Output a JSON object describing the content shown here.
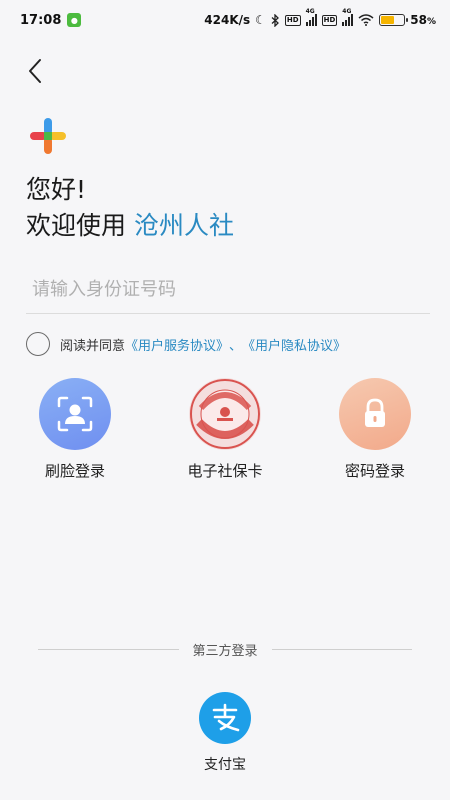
{
  "status_bar": {
    "time": "17:08",
    "network_speed": "424K/s",
    "hd1": "HD",
    "hd2": "HD",
    "net1": "4G",
    "net2": "4G",
    "battery": "58",
    "battery_level_percent": 58,
    "battery_color": "#f5b400"
  },
  "nav": {
    "back_icon": "chevron-left-icon"
  },
  "header": {
    "greeting": "您好!",
    "welcome_prefix": "欢迎使用",
    "app_name": "沧州人社",
    "accent_color": "#2a8ac2"
  },
  "form": {
    "id_placeholder": "请输入身份证号码",
    "id_value": ""
  },
  "agreement": {
    "prefix": "阅读并同意",
    "service_link": "《用户服务协议》",
    "separator": "、",
    "privacy_link": "《用户隐私协议》"
  },
  "login_methods": [
    {
      "label": "刷脸登录",
      "icon": "face-scan-icon"
    },
    {
      "label": "电子社保卡",
      "icon": "social-security-card-icon"
    },
    {
      "label": "密码登录",
      "icon": "lock-icon"
    }
  ],
  "third_party": {
    "divider_label": "第三方登录",
    "alipay_label": "支付宝",
    "alipay_icon": "alipay-icon",
    "alipay_color": "#1e9fe8"
  }
}
